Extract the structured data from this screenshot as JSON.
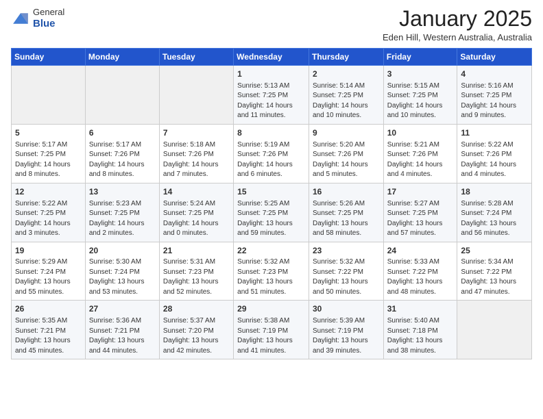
{
  "header": {
    "logo_general": "General",
    "logo_blue": "Blue",
    "month_title": "January 2025",
    "location": "Eden Hill, Western Australia, Australia"
  },
  "weekdays": [
    "Sunday",
    "Monday",
    "Tuesday",
    "Wednesday",
    "Thursday",
    "Friday",
    "Saturday"
  ],
  "weeks": [
    [
      {
        "day": "",
        "content": ""
      },
      {
        "day": "",
        "content": ""
      },
      {
        "day": "",
        "content": ""
      },
      {
        "day": "1",
        "content": "Sunrise: 5:13 AM\nSunset: 7:25 PM\nDaylight: 14 hours\nand 11 minutes."
      },
      {
        "day": "2",
        "content": "Sunrise: 5:14 AM\nSunset: 7:25 PM\nDaylight: 14 hours\nand 10 minutes."
      },
      {
        "day": "3",
        "content": "Sunrise: 5:15 AM\nSunset: 7:25 PM\nDaylight: 14 hours\nand 10 minutes."
      },
      {
        "day": "4",
        "content": "Sunrise: 5:16 AM\nSunset: 7:25 PM\nDaylight: 14 hours\nand 9 minutes."
      }
    ],
    [
      {
        "day": "5",
        "content": "Sunrise: 5:17 AM\nSunset: 7:25 PM\nDaylight: 14 hours\nand 8 minutes."
      },
      {
        "day": "6",
        "content": "Sunrise: 5:17 AM\nSunset: 7:26 PM\nDaylight: 14 hours\nand 8 minutes."
      },
      {
        "day": "7",
        "content": "Sunrise: 5:18 AM\nSunset: 7:26 PM\nDaylight: 14 hours\nand 7 minutes."
      },
      {
        "day": "8",
        "content": "Sunrise: 5:19 AM\nSunset: 7:26 PM\nDaylight: 14 hours\nand 6 minutes."
      },
      {
        "day": "9",
        "content": "Sunrise: 5:20 AM\nSunset: 7:26 PM\nDaylight: 14 hours\nand 5 minutes."
      },
      {
        "day": "10",
        "content": "Sunrise: 5:21 AM\nSunset: 7:26 PM\nDaylight: 14 hours\nand 4 minutes."
      },
      {
        "day": "11",
        "content": "Sunrise: 5:22 AM\nSunset: 7:26 PM\nDaylight: 14 hours\nand 4 minutes."
      }
    ],
    [
      {
        "day": "12",
        "content": "Sunrise: 5:22 AM\nSunset: 7:25 PM\nDaylight: 14 hours\nand 3 minutes."
      },
      {
        "day": "13",
        "content": "Sunrise: 5:23 AM\nSunset: 7:25 PM\nDaylight: 14 hours\nand 2 minutes."
      },
      {
        "day": "14",
        "content": "Sunrise: 5:24 AM\nSunset: 7:25 PM\nDaylight: 14 hours\nand 0 minutes."
      },
      {
        "day": "15",
        "content": "Sunrise: 5:25 AM\nSunset: 7:25 PM\nDaylight: 13 hours\nand 59 minutes."
      },
      {
        "day": "16",
        "content": "Sunrise: 5:26 AM\nSunset: 7:25 PM\nDaylight: 13 hours\nand 58 minutes."
      },
      {
        "day": "17",
        "content": "Sunrise: 5:27 AM\nSunset: 7:25 PM\nDaylight: 13 hours\nand 57 minutes."
      },
      {
        "day": "18",
        "content": "Sunrise: 5:28 AM\nSunset: 7:24 PM\nDaylight: 13 hours\nand 56 minutes."
      }
    ],
    [
      {
        "day": "19",
        "content": "Sunrise: 5:29 AM\nSunset: 7:24 PM\nDaylight: 13 hours\nand 55 minutes."
      },
      {
        "day": "20",
        "content": "Sunrise: 5:30 AM\nSunset: 7:24 PM\nDaylight: 13 hours\nand 53 minutes."
      },
      {
        "day": "21",
        "content": "Sunrise: 5:31 AM\nSunset: 7:23 PM\nDaylight: 13 hours\nand 52 minutes."
      },
      {
        "day": "22",
        "content": "Sunrise: 5:32 AM\nSunset: 7:23 PM\nDaylight: 13 hours\nand 51 minutes."
      },
      {
        "day": "23",
        "content": "Sunrise: 5:32 AM\nSunset: 7:22 PM\nDaylight: 13 hours\nand 50 minutes."
      },
      {
        "day": "24",
        "content": "Sunrise: 5:33 AM\nSunset: 7:22 PM\nDaylight: 13 hours\nand 48 minutes."
      },
      {
        "day": "25",
        "content": "Sunrise: 5:34 AM\nSunset: 7:22 PM\nDaylight: 13 hours\nand 47 minutes."
      }
    ],
    [
      {
        "day": "26",
        "content": "Sunrise: 5:35 AM\nSunset: 7:21 PM\nDaylight: 13 hours\nand 45 minutes."
      },
      {
        "day": "27",
        "content": "Sunrise: 5:36 AM\nSunset: 7:21 PM\nDaylight: 13 hours\nand 44 minutes."
      },
      {
        "day": "28",
        "content": "Sunrise: 5:37 AM\nSunset: 7:20 PM\nDaylight: 13 hours\nand 42 minutes."
      },
      {
        "day": "29",
        "content": "Sunrise: 5:38 AM\nSunset: 7:19 PM\nDaylight: 13 hours\nand 41 minutes."
      },
      {
        "day": "30",
        "content": "Sunrise: 5:39 AM\nSunset: 7:19 PM\nDaylight: 13 hours\nand 39 minutes."
      },
      {
        "day": "31",
        "content": "Sunrise: 5:40 AM\nSunset: 7:18 PM\nDaylight: 13 hours\nand 38 minutes."
      },
      {
        "day": "",
        "content": ""
      }
    ]
  ]
}
